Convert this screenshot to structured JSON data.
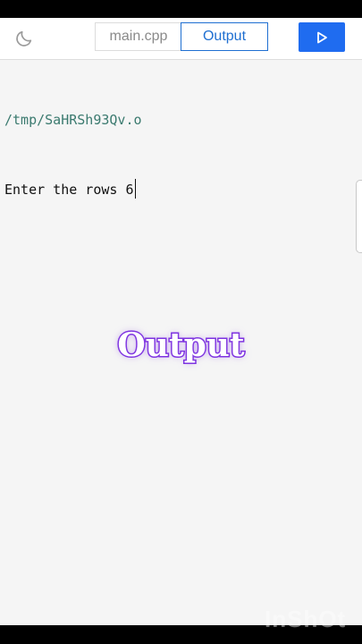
{
  "toolbar": {
    "theme_icon": "moon-icon",
    "tabs": [
      {
        "label": "main.cpp",
        "active": false
      },
      {
        "label": "Output",
        "active": true
      }
    ],
    "run_icon": "play-icon"
  },
  "console": {
    "path": "/tmp/SaHRSh93Qv.o",
    "prompt": "Enter the rows 6"
  },
  "overlay": {
    "title": "Output"
  },
  "watermark": {
    "text": "InShOt"
  },
  "colors": {
    "accent": "#1f6fd1",
    "run_button": "#1f6cf0",
    "path_text": "#3b7a6f",
    "overlay_stroke": "#7b2ee0"
  }
}
